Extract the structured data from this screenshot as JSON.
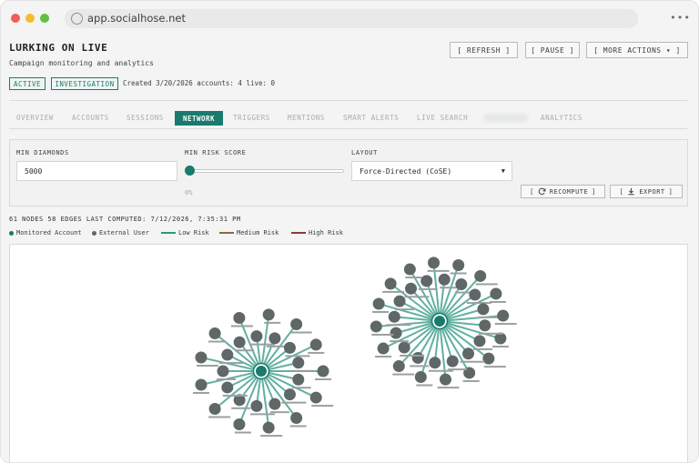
{
  "browser": {
    "url": "app.socialhose.net",
    "menu_glyph": "•••"
  },
  "header": {
    "title": "LURKING ON LIVE",
    "subtitle": "Campaign monitoring and analytics",
    "buttons": {
      "refresh": "[ REFRESH ]",
      "pause": "[ PAUSE ]",
      "more": "[ MORE ACTIONS ▾ ]"
    },
    "badges": {
      "active": "ACTIVE",
      "investigation": "INVESTIGATION"
    },
    "meta": "Created 3/20/2026 accounts: 4 live: 0"
  },
  "tabs": {
    "overview": "OVERVIEW",
    "accounts": "ACCOUNTS",
    "sessions": "SESSIONS",
    "network": "NETWORK",
    "triggers": "TRIGGERS",
    "mentions": "MENTIONS",
    "smart_alerts": "SMART ALERTS",
    "live_search": "LIVE SEARCH",
    "analytics": "ANALYTICS",
    "active": "NETWORK"
  },
  "controls": {
    "min_diamonds_label": "MIN DIAMONDS",
    "min_diamonds_value": "5000",
    "min_risk_label": "MIN RISK SCORE",
    "min_risk_value_text": "0%",
    "min_risk_value": 0,
    "layout_label": "LAYOUT",
    "layout_value": "Force-Directed (CoSE)",
    "recompute_label": "RECOMPUTE",
    "export_label": "EXPORT"
  },
  "stats": "61 NODES  58 EDGES  LAST COMPUTED: 7/12/2026, 7:35:31 PM",
  "legend": {
    "monitored": "Monitored Account",
    "external": "External User",
    "low": "Low Risk",
    "medium": "Medium Risk",
    "high": "High Risk"
  },
  "colors": {
    "accent": "#1a7a6d",
    "monitored_node": "#1a7a6d",
    "external_node": "#5f6866",
    "low_risk": "#2e9682",
    "medium_risk": "#8a6a3c",
    "high_risk": "#8a3a34"
  },
  "network": {
    "clusters": [
      {
        "hub": "monitored-account-1",
        "neighbor_count": 26
      },
      {
        "hub": "monitored-account-2",
        "neighbor_count": 32
      }
    ]
  }
}
